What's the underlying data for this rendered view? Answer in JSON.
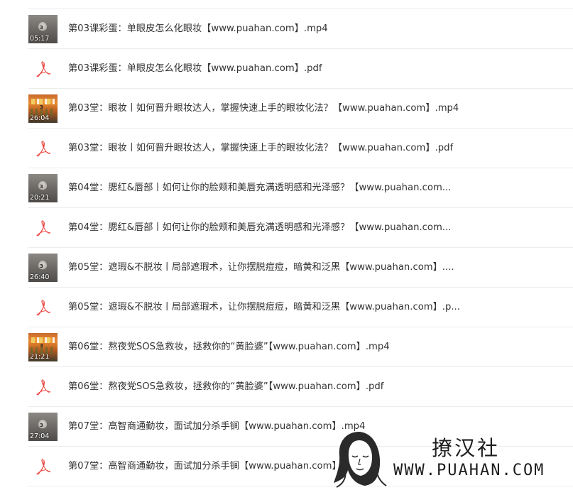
{
  "files": [
    {
      "kind": "video",
      "thumb": "dark",
      "duration": "05:17",
      "name": "第03课彩蛋：单眼皮怎么化眼妆【www.puahan.com】.mp4"
    },
    {
      "kind": "pdf",
      "name": "第03课彩蛋：单眼皮怎么化眼妆【www.puahan.com】.pdf"
    },
    {
      "kind": "video",
      "thumb": "color",
      "duration": "26:04",
      "name": "第03堂：眼妆丨如何晋升眼妆达人，掌握快速上手的眼妆化法？【www.puahan.com】.mp4"
    },
    {
      "kind": "pdf",
      "name": "第03堂：眼妆丨如何晋升眼妆达人，掌握快速上手的眼妆化法？【www.puahan.com】.pdf"
    },
    {
      "kind": "video",
      "thumb": "dark",
      "duration": "20:21",
      "name": "第04堂：腮红&唇部丨如何让你的脸颊和美唇充满透明感和光泽感？【www.puahan.com..."
    },
    {
      "kind": "pdf",
      "name": "第04堂：腮红&唇部丨如何让你的脸颊和美唇充满透明感和光泽感？【www.puahan.com..."
    },
    {
      "kind": "video",
      "thumb": "dark",
      "duration": "26:40",
      "name": "第05堂：遮瑕&不脱妆丨局部遮瑕术，让你摆脱痘痘，暗黄和泛黑【www.puahan.com】...."
    },
    {
      "kind": "pdf",
      "name": "第05堂：遮瑕&不脱妆丨局部遮瑕术，让你摆脱痘痘，暗黄和泛黑【www.puahan.com】.p..."
    },
    {
      "kind": "video",
      "thumb": "color",
      "duration": "21:21",
      "name": "第06堂：熬夜党SOS急救妆，拯救你的“黄脸婆”【www.puahan.com】.mp4"
    },
    {
      "kind": "pdf",
      "name": "第06堂：熬夜党SOS急救妆，拯救你的“黄脸婆”【www.puahan.com】.pdf"
    },
    {
      "kind": "video",
      "thumb": "dark",
      "duration": "27:04",
      "name": "第07堂：高智商通勤妆，面试加分杀手锏【www.puahan.com】.mp4"
    },
    {
      "kind": "pdf",
      "name": "第07堂：高智商通勤妆，面试加分杀手锏【www.puahan.com】.pdf"
    }
  ],
  "thumb_mark": "3",
  "pdf_icon": "acrobat-pdf-icon",
  "colors": {
    "pdf_red": "#e8413b",
    "text": "#333333",
    "divider": "#ececec"
  },
  "watermark": {
    "title": "撩汉社",
    "url": "WWW.PUAHAN.COM"
  }
}
